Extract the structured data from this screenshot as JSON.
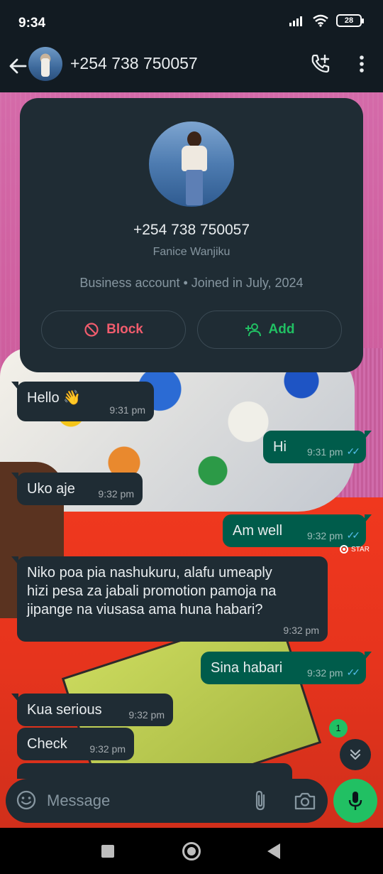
{
  "status_bar": {
    "time": "9:34",
    "battery": "28"
  },
  "header": {
    "title": "+254 738 750057"
  },
  "profile_card": {
    "phone": "+254 738 750057",
    "name": "Fanice Wanjiku",
    "meta": "Business account • Joined in July, 2024",
    "block_label": "Block",
    "add_label": "Add"
  },
  "messages": [
    {
      "direction": "in",
      "text": "Hello 👋",
      "time": "9:31 pm"
    },
    {
      "direction": "out",
      "text": "Hi",
      "time": "9:31 pm",
      "read": true
    },
    {
      "direction": "in",
      "text": "Uko aje",
      "time": "9:32 pm"
    },
    {
      "direction": "out",
      "text": "Am well",
      "time": "9:32 pm",
      "read": true
    },
    {
      "direction": "in",
      "text": "Niko poa pia nashukuru, alafu umeaply\nhizi pesa za jabali promotion pamoja na\njipange na viusasa ama huna habari?",
      "time": "9:32 pm"
    },
    {
      "direction": "out",
      "text": "Sina habari",
      "time": "9:32 pm",
      "read": true
    },
    {
      "direction": "in",
      "text": "Kua serious",
      "time": "9:32 pm"
    },
    {
      "direction": "in",
      "text": "Check",
      "time": "9:32 pm"
    }
  ],
  "status_tag": "STAR",
  "unread_count": "1",
  "composer": {
    "placeholder": "Message"
  },
  "colors": {
    "incoming_bubble": "#1f2c34",
    "outgoing_bubble": "#005c4b",
    "accent_green": "#21c063",
    "block_red": "#f15c6d",
    "read_ticks": "#53bdeb"
  },
  "icons": [
    "back-arrow-icon",
    "add-call-icon",
    "more-vert-icon",
    "block-icon",
    "add-person-icon",
    "emoji-icon",
    "attach-icon",
    "camera-icon",
    "mic-icon",
    "chevrons-down-icon"
  ]
}
